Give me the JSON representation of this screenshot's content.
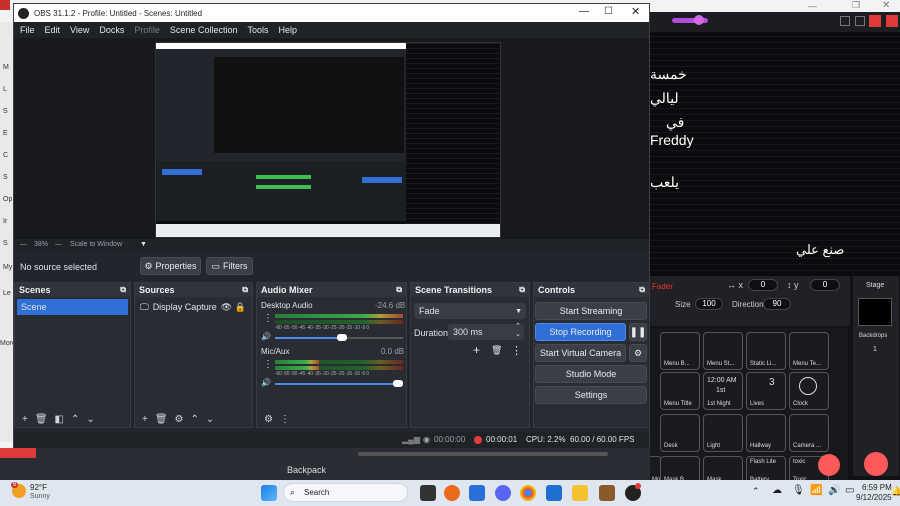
{
  "obs": {
    "title": "OBS 31.1.2 - Profile: Untitled - Scenes: Untitled",
    "menu": [
      "File",
      "Edit",
      "View",
      "Docks",
      "Profile",
      "Scene Collection",
      "Tools",
      "Help"
    ],
    "zoom": "38%",
    "zoom_mode": "Scale to Window",
    "no_source": "No source selected",
    "properties": "Properties",
    "filters": "Filters",
    "scenes": {
      "title": "Scenes",
      "items": [
        "Scene"
      ]
    },
    "sources": {
      "title": "Sources",
      "items": [
        "Display Capture"
      ]
    },
    "mixer": {
      "title": "Audio Mixer",
      "channels": [
        {
          "name": "Desktop Audio",
          "db": "-24.6 dB",
          "level": 0.55,
          "volume": 0.52
        },
        {
          "name": "Mic/Aux",
          "db": "0.0 dB",
          "level": 0.35,
          "volume": 0.98
        }
      ],
      "ticks": [
        "-60",
        "-55",
        "-50",
        "-45",
        "-40",
        "-35",
        "-30",
        "-25",
        "-20",
        "-15",
        "-10",
        "-5",
        "0"
      ]
    },
    "transitions": {
      "title": "Scene Transitions",
      "type": "Fade",
      "duration_label": "Duration",
      "duration": "300 ms"
    },
    "controls": {
      "title": "Controls",
      "start_streaming": "Start Streaming",
      "stop_recording": "Stop Recording",
      "start_virtual_camera": "Start Virtual Camera",
      "studio_mode": "Studio Mode",
      "settings": "Settings"
    },
    "status": {
      "stream_time": "00:00:00",
      "rec_time": "00:00:01",
      "cpu": "CPU: 2.2%",
      "fps": "60.00 / 60.00 FPS"
    }
  },
  "background_app": {
    "arabic_lines": [
      "خمسة",
      "ليالي",
      "في",
      "Freddy",
      "يلعب",
      "صنع علي"
    ],
    "fader_label": "Fader",
    "x_value": "0",
    "y_value": "0",
    "size_label": "Size",
    "size_value": "100",
    "direction_label": "Direction",
    "direction_value": "90",
    "stage_label": "Stage",
    "backdrops_label": "Backdrops",
    "backdrops_count": "1",
    "backpack": "Backpack",
    "sprites": [
      "Menu B...",
      "Menu St...",
      "Static Li...",
      "Menu Te...",
      "Menu Title",
      "1st Night",
      "Lives",
      "Clock",
      "Desk",
      "Light",
      "Hallway",
      "Camera ...",
      "Monitor",
      "Mask B...",
      "Mask",
      "Battery",
      "Toxic"
    ],
    "tile_texts": {
      "time": "12:00 AM",
      "night": "1st",
      "lives_num": "3",
      "battery": "Flash Lite",
      "toxic": "toxic"
    }
  },
  "taskbar": {
    "weather_temp": "92°F",
    "weather_desc": "Sunny",
    "weather_badge": "6",
    "search": "Search",
    "time": "6:59 PM",
    "date": "9/12/2025"
  },
  "left_strip_letters": [
    "M",
    "L",
    "S",
    "E",
    "C",
    "S",
    "Op",
    "Ir",
    "S",
    "My",
    "Le",
    "More"
  ]
}
